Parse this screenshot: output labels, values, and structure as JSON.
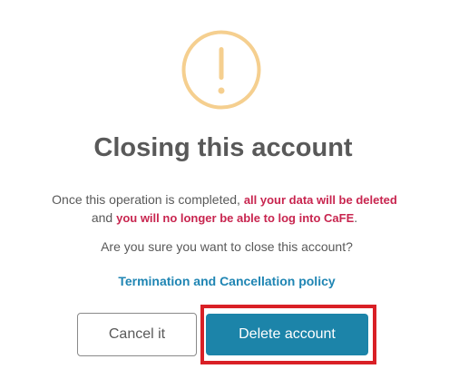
{
  "dialog": {
    "title": "Closing this account",
    "message": {
      "line1_prefix": "Once this operation is completed, ",
      "line1_emphasis": "all your data will be deleted",
      "line2_prefix": "and ",
      "line2_emphasis": "you will no longer be able to log into CaFE",
      "line2_suffix": "."
    },
    "question": "Are you sure you want to close this account?",
    "policy_link": "Termination and Cancellation policy",
    "buttons": {
      "cancel_label": "Cancel it",
      "delete_label": "Delete account"
    }
  },
  "icons": {
    "warning": "exclamation-circle-icon"
  },
  "colors": {
    "warning_icon": "#f5cf8f",
    "title_text": "#595959",
    "emphasis_text": "#c8254f",
    "link_text": "#1f85b3",
    "primary_button": "#1c84a9",
    "highlight_border": "#d92026"
  }
}
